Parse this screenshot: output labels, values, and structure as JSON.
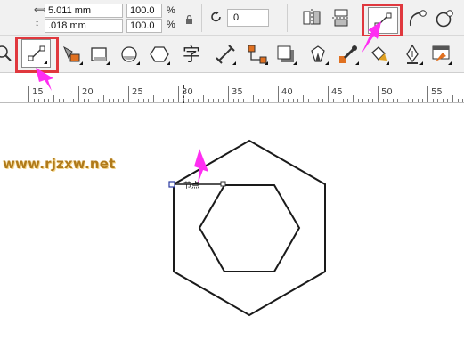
{
  "property_bar": {
    "width_value": "5.011 mm",
    "height_value": ".018 mm",
    "scale_x": "100.0",
    "scale_y": "100.0",
    "percent_x": "%",
    "percent_y": "%",
    "rotation_value": ".0"
  },
  "ruler": {
    "ticks": [
      "15",
      "20",
      "25",
      "30",
      "35",
      "40",
      "45",
      "50",
      "55"
    ]
  },
  "canvas": {
    "watermark": "www.rjzxw.net",
    "node_label": "节点"
  },
  "colors": {
    "highlight": "#e0383e",
    "arrow": "#ff2ef2",
    "toolbar_bg": "#f1f1f1",
    "watermark": "#b07a1a"
  },
  "icons": [
    "width-arrows-icon",
    "height-arrows-icon",
    "lock-icon",
    "rotate-icon",
    "mirror-horizontal-icon",
    "mirror-vertical-icon",
    "line-segment-icon",
    "curve-segment-icon",
    "smooth-node-icon",
    "zoom-icon",
    "shape-line-tool-icon",
    "smart-fill-icon",
    "rectangle-tool-icon",
    "ellipse-tool-icon",
    "polygon-tool-icon",
    "text-tool-icon",
    "dimension-tool-icon",
    "connector-tool-icon",
    "drop-shadow-icon",
    "transparency-icon",
    "eyedropper-icon",
    "fill-bucket-icon",
    "pen-outline-icon",
    "interactive-fill-icon"
  ]
}
